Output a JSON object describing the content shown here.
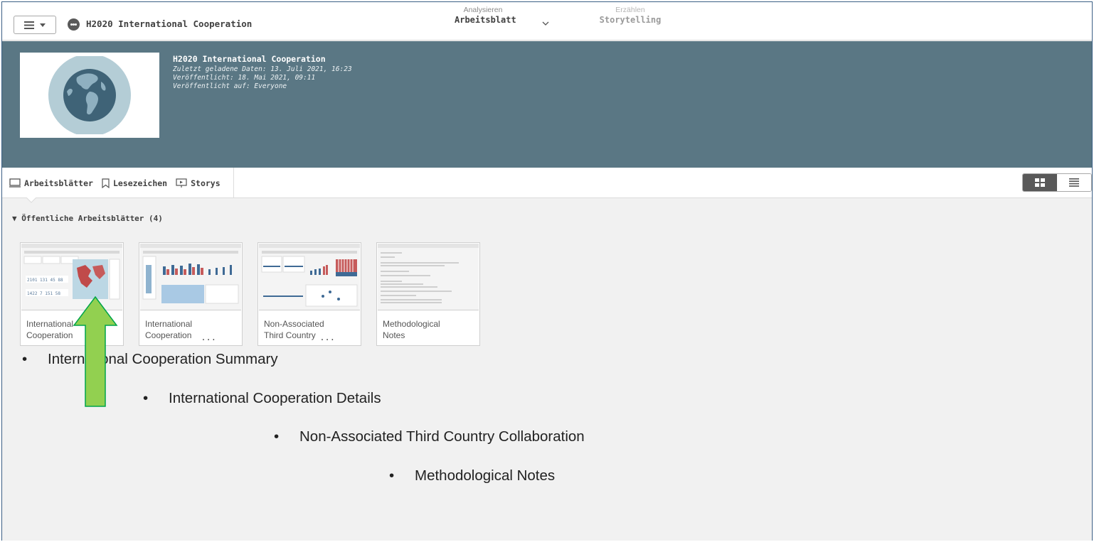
{
  "toolbar": {
    "app_title": "H2020 International Cooperation",
    "analyze_label": "Analysieren",
    "sheet_label": "Arbeitsblatt",
    "narrate_label": "Erzählen",
    "storytelling_label": "Storytelling"
  },
  "app_header": {
    "title": "H2020 International Cooperation",
    "reload_line": "Zuletzt geladene Daten: 13. Juli 2021, 16:23",
    "published_line": "Veröffentlicht: 18. Mai 2021, 09:11",
    "published_to_line": "Veröffentlicht auf: Everyone"
  },
  "tabs": {
    "sheets": "Arbeitsblätter",
    "bookmarks": "Lesezeichen",
    "stories": "Storys"
  },
  "section": {
    "title": "▼ Öffentliche Arbeitsblätter (4)"
  },
  "sheets": [
    {
      "label": "International\nCooperation",
      "truncated": false
    },
    {
      "label": "International\nCooperation",
      "more": "..."
    },
    {
      "label": "Non-Associated\nThird Country",
      "more": "..."
    },
    {
      "label": "Methodological\nNotes"
    }
  ],
  "annotations": {
    "bullet": "•",
    "items": [
      "International Cooperation Summary",
      "International Cooperation Details",
      "Non-Associated Third Country Collaboration",
      "Methodological Notes"
    ],
    "arrow_color": "#92d050",
    "arrow_border": "#00a44a"
  },
  "colors": {
    "header_band": "#5a7784",
    "frame_border": "#3b5f85"
  }
}
